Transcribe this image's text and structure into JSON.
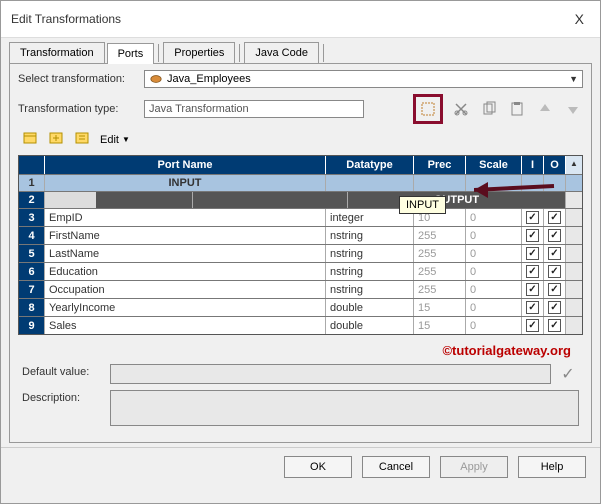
{
  "window": {
    "title": "Edit Transformations",
    "close": "X"
  },
  "tabs": [
    "Transformation",
    "Ports",
    "Properties",
    "Java Code"
  ],
  "active_tab_index": 1,
  "form": {
    "select_label": "Select transformation:",
    "select_value": "Java_Employees",
    "type_label": "Transformation type:",
    "type_value": "Java Transformation",
    "edit_menu": "Edit"
  },
  "grid": {
    "headers": {
      "name": "Port Name",
      "dtype": "Datatype",
      "prec": "Prec",
      "scale": "Scale",
      "i": "I",
      "o": "O"
    },
    "input_row_label": "INPUT",
    "output_row_label": "OUTPUT",
    "tooltip": "INPUT",
    "rows": [
      {
        "n": "3",
        "name": "EmpID",
        "dtype": "integer",
        "prec": "10",
        "scale": "0",
        "i": true,
        "o": true
      },
      {
        "n": "4",
        "name": "FirstName",
        "dtype": "nstring",
        "prec": "255",
        "scale": "0",
        "i": true,
        "o": true
      },
      {
        "n": "5",
        "name": "LastName",
        "dtype": "nstring",
        "prec": "255",
        "scale": "0",
        "i": true,
        "o": true
      },
      {
        "n": "6",
        "name": "Education",
        "dtype": "nstring",
        "prec": "255",
        "scale": "0",
        "i": true,
        "o": true
      },
      {
        "n": "7",
        "name": "Occupation",
        "dtype": "nstring",
        "prec": "255",
        "scale": "0",
        "i": true,
        "o": true
      },
      {
        "n": "8",
        "name": "YearlyIncome",
        "dtype": "double",
        "prec": "15",
        "scale": "0",
        "i": true,
        "o": true
      },
      {
        "n": "9",
        "name": "Sales",
        "dtype": "double",
        "prec": "15",
        "scale": "0",
        "i": true,
        "o": true
      }
    ]
  },
  "watermark": "©tutorialgateway.org",
  "bottom": {
    "default_label": "Default value:",
    "desc_label": "Description:"
  },
  "buttons": {
    "ok": "OK",
    "cancel": "Cancel",
    "apply": "Apply",
    "help": "Help"
  }
}
